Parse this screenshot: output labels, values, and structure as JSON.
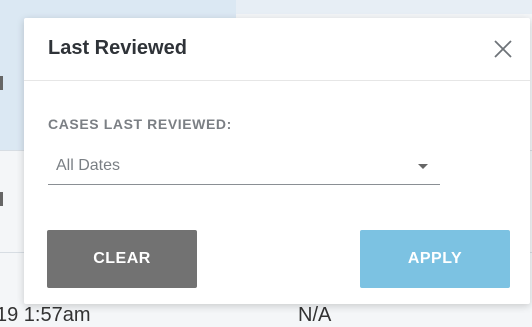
{
  "popover": {
    "title": "Last Reviewed",
    "close_icon": "close-icon",
    "field_label": "CASES LAST REVIEWED:",
    "select_value": "All Dates",
    "clear_label": "CLEAR",
    "apply_label": "APPLY",
    "colors": {
      "clear_bg": "#727272",
      "apply_bg": "#7cc2e2"
    }
  },
  "background": {
    "row_time_partial": "19 1:57am",
    "row_status_partial": "N/A"
  }
}
